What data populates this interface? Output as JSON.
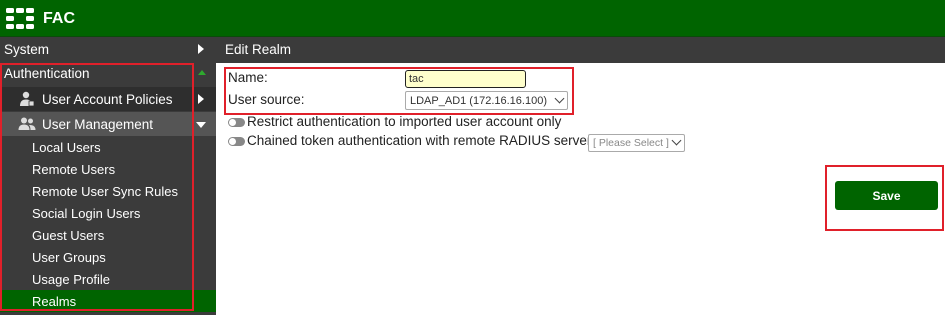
{
  "app": {
    "title": "FAC",
    "logo": "fortinet-grid-icon"
  },
  "sidebar": {
    "sections": [
      {
        "label": "System",
        "icon": "chevron-right-icon"
      },
      {
        "label": "Authentication",
        "icon": "chevron-up-icon"
      }
    ],
    "items": [
      {
        "label": "User Account Policies",
        "icon": "user-policy-icon"
      },
      {
        "label": "User Management",
        "icon": "users-icon"
      }
    ],
    "subitems": [
      "Local Users",
      "Remote Users",
      "Remote User Sync Rules",
      "Social Login Users",
      "Guest Users",
      "User Groups",
      "Usage Profile",
      "Realms"
    ],
    "selected": "Realms"
  },
  "content": {
    "header": "Edit Realm",
    "name_label": "Name:",
    "name_value": "tac",
    "user_source_label": "User source:",
    "user_source_value": "LDAP_AD1 (172.16.16.100)",
    "restrict_label": "Restrict authentication to imported user account only",
    "restrict_enabled": false,
    "chained_label": "Chained token authentication with remote RADIUS server",
    "chained_enabled": false,
    "radius_placeholder": "[ Please Select ]",
    "save_label": "Save"
  },
  "colors": {
    "brand_green": "#006400",
    "sidebar_bg": "#3b3b3b",
    "highlight_red": "#e0202a"
  }
}
